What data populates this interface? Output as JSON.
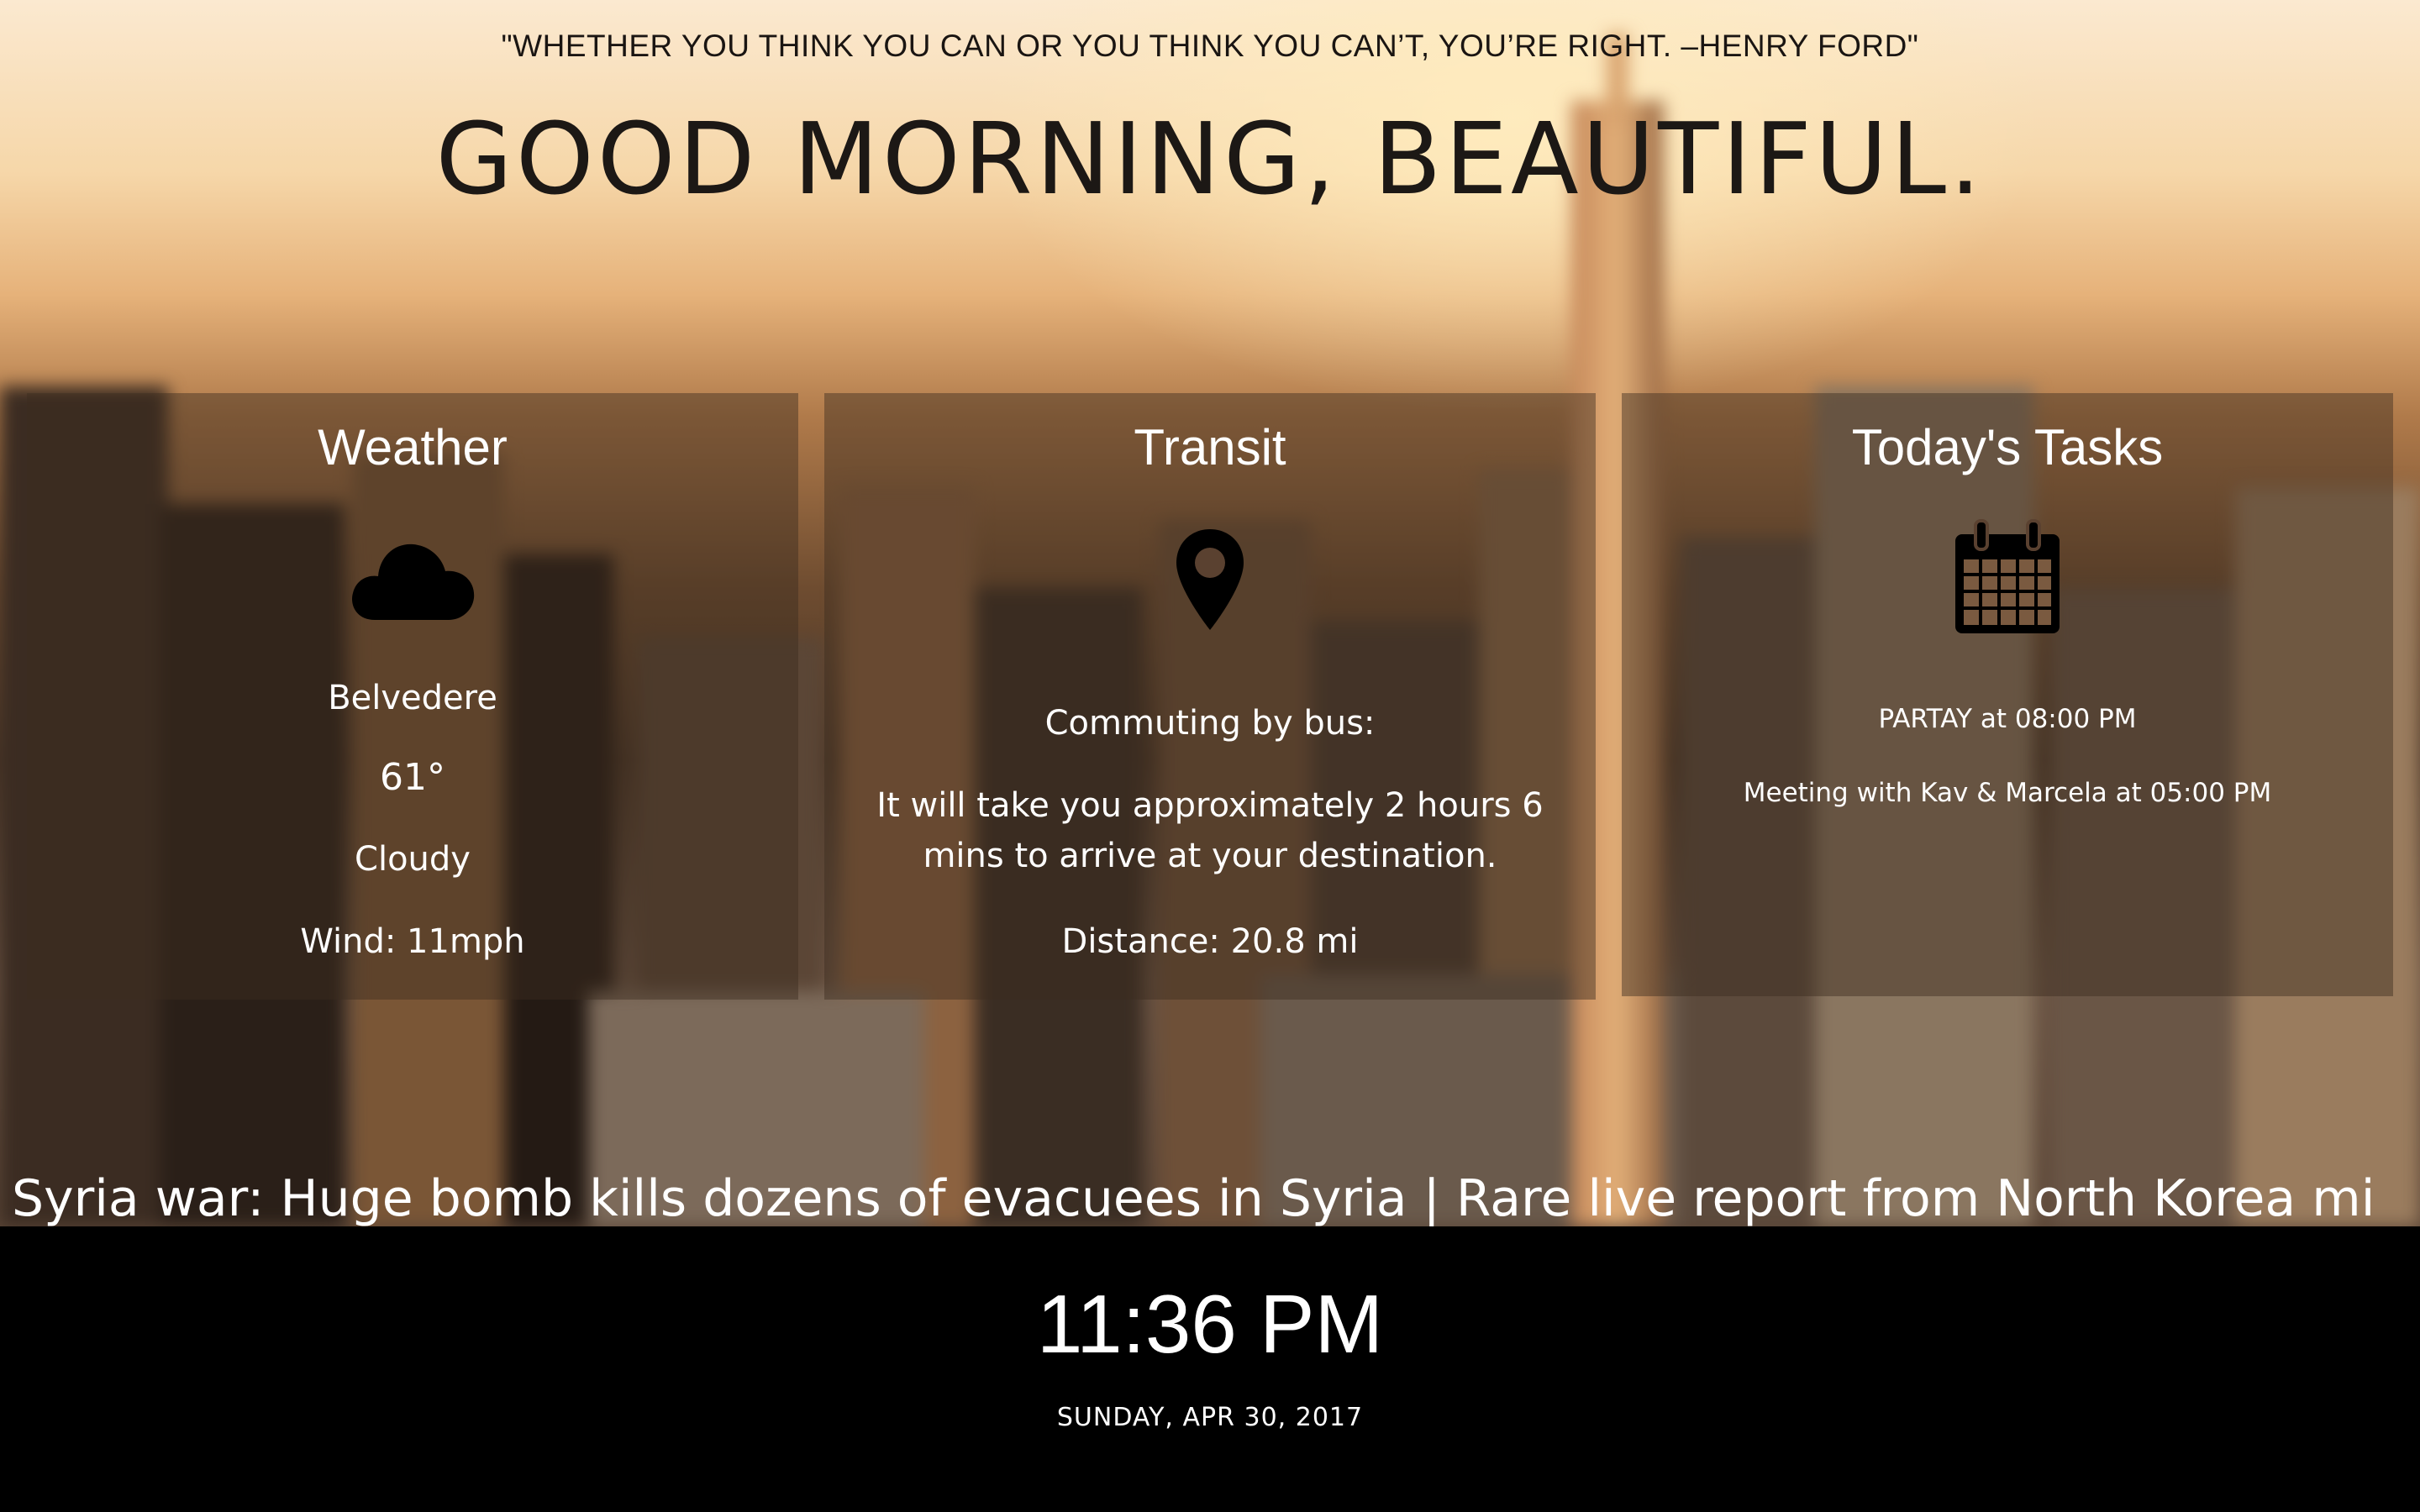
{
  "header": {
    "quote": "\"WHETHER YOU THINK YOU CAN OR YOU THINK YOU CAN’T, YOU’RE RIGHT. –HENRY FORD\"",
    "greeting": "GOOD MORNING, BEAUTIFUL."
  },
  "weather": {
    "title": "Weather",
    "icon": "cloud-icon",
    "location": "Belvedere",
    "temperature": "61°",
    "condition": "Cloudy",
    "wind": "Wind: 11mph"
  },
  "transit": {
    "title": "Transit",
    "icon": "map-pin-icon",
    "mode": "Commuting by bus:",
    "eta_line1": "It will take you approximately 2 hours 6",
    "eta_line2": "mins to arrive at your destination.",
    "distance": "Distance: 20.8 mi"
  },
  "tasks": {
    "title": "Today's Tasks",
    "icon": "calendar-icon",
    "items": [
      "PARTAY at 08:00 PM",
      "Meeting with Kav & Marcela at 05:00 PM"
    ]
  },
  "news_ticker": {
    "text": "Syria war: Huge bomb kills dozens of evacuees in Syria | Rare live report from North Korea mi"
  },
  "footer": {
    "time": "11:36 PM",
    "date": "SUNDAY, APR 30, 2017"
  },
  "colors": {
    "panel_bg": "#3c2c1e",
    "text": "#ffffff",
    "heading": "#1c1815",
    "footer_bg": "#000000"
  }
}
